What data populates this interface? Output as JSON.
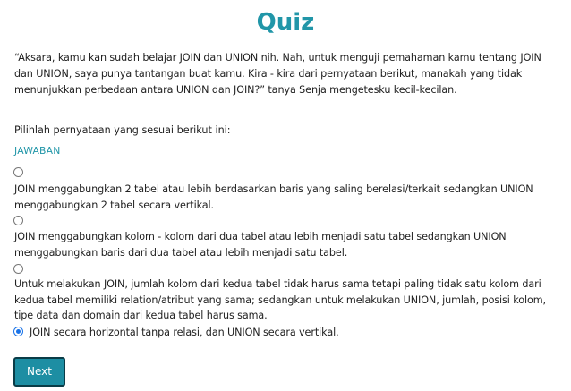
{
  "quiz": {
    "title": "Quiz",
    "story": "“Aksara, kamu kan sudah belajar JOIN dan UNION nih. Nah, untuk menguji pemahaman kamu tentang JOIN dan UNION, saya punya tantangan buat kamu. Kira - kira dari pernyataan berikut, manakah yang tidak menunjukkan perbedaan antara UNION dan JOIN?” tanya Senja mengetesku kecil-kecilan.",
    "instruction": "Pilihlah pernyataan yang sesuai berikut ini:",
    "answer_label": "JAWABAN",
    "options": [
      {
        "text": "JOIN menggabungkan 2 tabel atau lebih berdasarkan baris yang saling berelasi/terkait sedangkan UNION menggabungkan 2 tabel secara vertikal.",
        "selected": false
      },
      {
        "text": "JOIN menggabungkan kolom - kolom dari dua tabel atau lebih menjadi satu tabel sedangkan UNION menggabungkan baris dari dua tabel atau lebih menjadi satu tabel.",
        "selected": false
      },
      {
        "text": "Untuk melakukan JOIN, jumlah kolom dari kedua tabel tidak harus sama tetapi paling tidak satu kolom dari kedua tabel memiliki relation/atribut yang sama; sedangkan untuk melakukan UNION, jumlah, posisi kolom, tipe data dan domain dari kedua tabel harus sama.",
        "selected": false
      },
      {
        "text": "JOIN secara horizontal tanpa relasi, dan UNION secara vertikal.",
        "selected": true
      }
    ],
    "next_label": "Next"
  },
  "colors": {
    "accent": "#2196a8",
    "button_bg": "#1d8ea3",
    "button_border": "#0a3c47",
    "radio_selected": "#1a73e8",
    "text": "#212121"
  }
}
